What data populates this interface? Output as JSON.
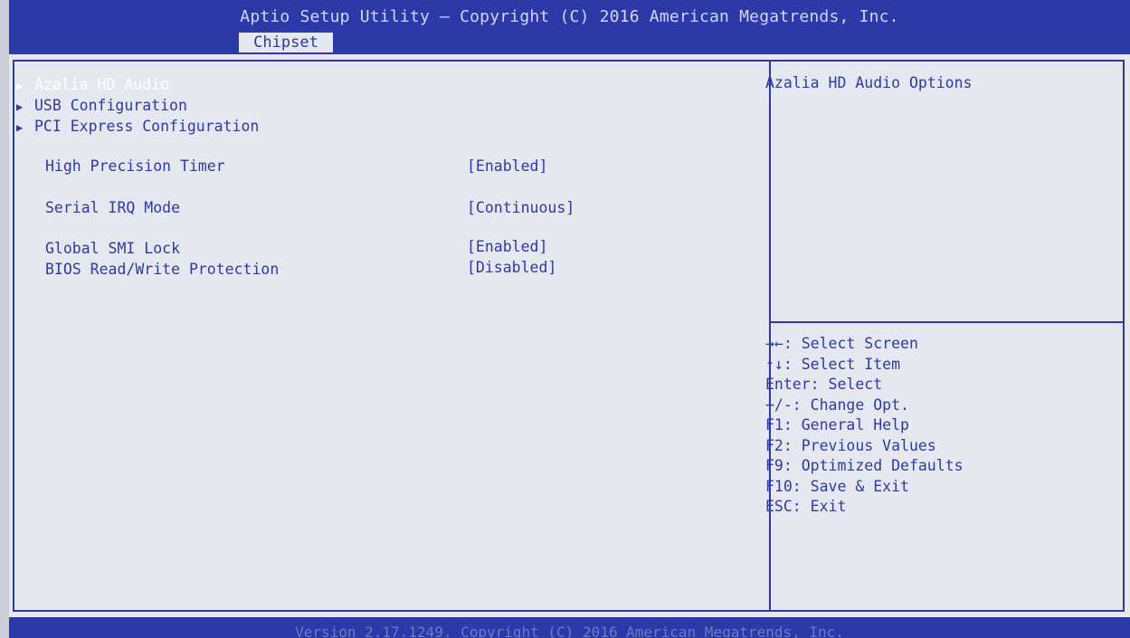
{
  "header": {
    "title": "Aptio Setup Utility – Copyright (C) 2016 American Megatrends, Inc.",
    "active_tab": "Chipset"
  },
  "menu": {
    "submenus": [
      {
        "label": "Azalia HD Audio",
        "selected": true
      },
      {
        "label": "USB Configuration",
        "selected": false
      },
      {
        "label": "PCI Express Configuration",
        "selected": false
      }
    ],
    "settings": [
      {
        "label": "High Precision Timer",
        "value": "[Enabled]"
      },
      {
        "label": "Serial IRQ Mode",
        "value": "[Continuous]"
      },
      {
        "label": "Global SMI Lock",
        "value": "[Enabled]"
      },
      {
        "label": "BIOS Read/Write Protection",
        "value": "[Disabled]"
      }
    ]
  },
  "help": {
    "description": "Azalia HD Audio Options"
  },
  "keys": [
    "→←: Select Screen",
    "↑↓: Select Item",
    "Enter: Select",
    "+/-: Change Opt.",
    "F1: General Help",
    "F2: Previous Values",
    "F9: Optimized Defaults",
    "F10: Save & Exit",
    "ESC: Exit"
  ],
  "footer": {
    "text": "Version 2.17.1249. Copyright (C) 2016 American Megatrends, Inc."
  },
  "colors": {
    "bar_blue": "#2d39a8",
    "panel": "#e6e8f1",
    "highlight_text": "#ffffff"
  }
}
